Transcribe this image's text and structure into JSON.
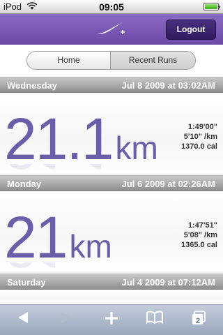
{
  "status_bar": {
    "carrier": "iPod",
    "time": "09:05"
  },
  "header": {
    "logo": "nike-plus-logo",
    "logout_label": "Logout"
  },
  "tabs": [
    {
      "label": "Home",
      "selected": false
    },
    {
      "label": "Recent Runs",
      "selected": true
    }
  ],
  "runs": [
    {
      "day": "Wednesday",
      "date": "Jul 8 2009 at 03:02AM",
      "distance": "21.1",
      "unit": "km",
      "duration": "1:49'00\"",
      "pace": "5'10\" /km",
      "calories": "1370.0 cal"
    },
    {
      "day": "Monday",
      "date": "Jul 6 2009 at 02:26AM",
      "distance": "21",
      "unit": "km",
      "duration": "1:47'51\"",
      "pace": "5'08\" /km",
      "calories": "1365.0 cal"
    },
    {
      "day": "Saturday",
      "date": "Jul 4 2009 at 07:12AM"
    }
  ],
  "toolbar": {
    "back": "back-arrow-icon",
    "forward": "forward-arrow-icon",
    "add": "add-icon",
    "bookmarks": "bookmarks-icon",
    "pages": "pages-icon",
    "pages_count": "2"
  },
  "colors": {
    "header": "#7a5ab4",
    "distance": "#6b5ea8"
  }
}
